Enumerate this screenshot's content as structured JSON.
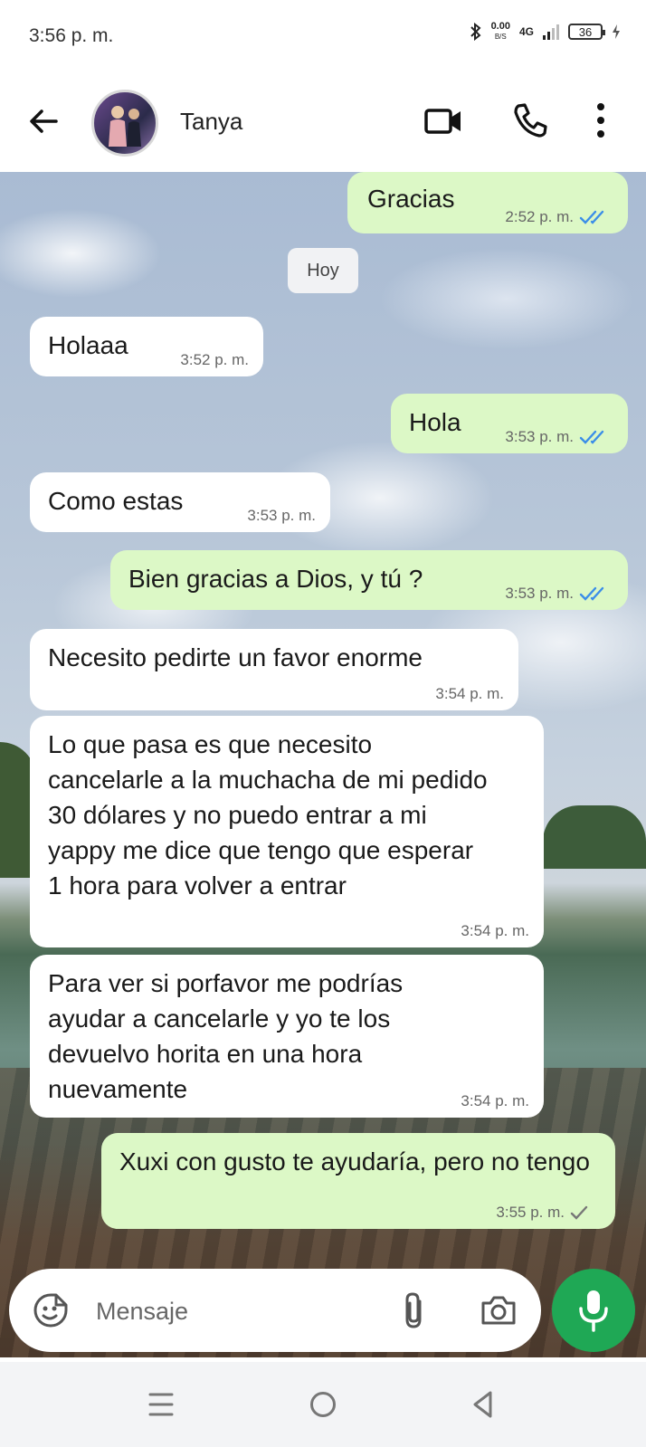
{
  "status_bar": {
    "time": "3:56 p. m.",
    "net_speed_value": "0.00",
    "net_speed_unit": "B/S",
    "network": "4G",
    "battery": "36",
    "icons": [
      "bluetooth-icon",
      "signal-icon",
      "battery-icon",
      "charging-icon"
    ]
  },
  "header": {
    "contact_name": "Tanya",
    "icons": [
      "back-arrow-icon",
      "video-call-icon",
      "phone-icon",
      "more-vert-icon"
    ]
  },
  "date_chip": "Hoy",
  "messages": [
    {
      "direction": "out",
      "text": "Gracias",
      "time": "2:52 p. m.",
      "status": "read"
    },
    {
      "direction": "in",
      "text": "Holaaa",
      "time": "3:52 p. m."
    },
    {
      "direction": "out",
      "text": "Hola",
      "time": "3:53 p. m.",
      "status": "read"
    },
    {
      "direction": "in",
      "text": "Como estas",
      "time": "3:53 p. m."
    },
    {
      "direction": "out",
      "text": "Bien gracias a Dios, y tú ?",
      "time": "3:53 p. m.",
      "status": "read"
    },
    {
      "direction": "in",
      "text": "Necesito pedirte un favor enorme",
      "time": "3:54 p. m."
    },
    {
      "direction": "in",
      "text": "Lo que pasa es que necesito cancelarle a la muchacha de mi pedido 30 dólares y no puedo entrar a mi yappy me dice que tengo que esperar 1 hora para volver a entrar",
      "time": "3:54 p. m."
    },
    {
      "direction": "in",
      "text": "Para ver si porfavor me podrías ayudar a cancelarle y yo te los devuelvo horita en una hora nuevamente",
      "time": "3:54 p. m."
    },
    {
      "direction": "out",
      "text": "Xuxi con gusto te ayudaría, pero no tengo",
      "time": "3:55 p. m.",
      "status": "sent"
    }
  ],
  "input": {
    "placeholder": "Mensaje",
    "icons": [
      "emoji-icon",
      "attach-icon",
      "camera-icon",
      "mic-icon"
    ]
  },
  "colors": {
    "outgoing_bubble": "#dcf8c6",
    "incoming_bubble": "#ffffff",
    "read_ticks": "#34b7f1",
    "mic_button": "#1fa855"
  }
}
